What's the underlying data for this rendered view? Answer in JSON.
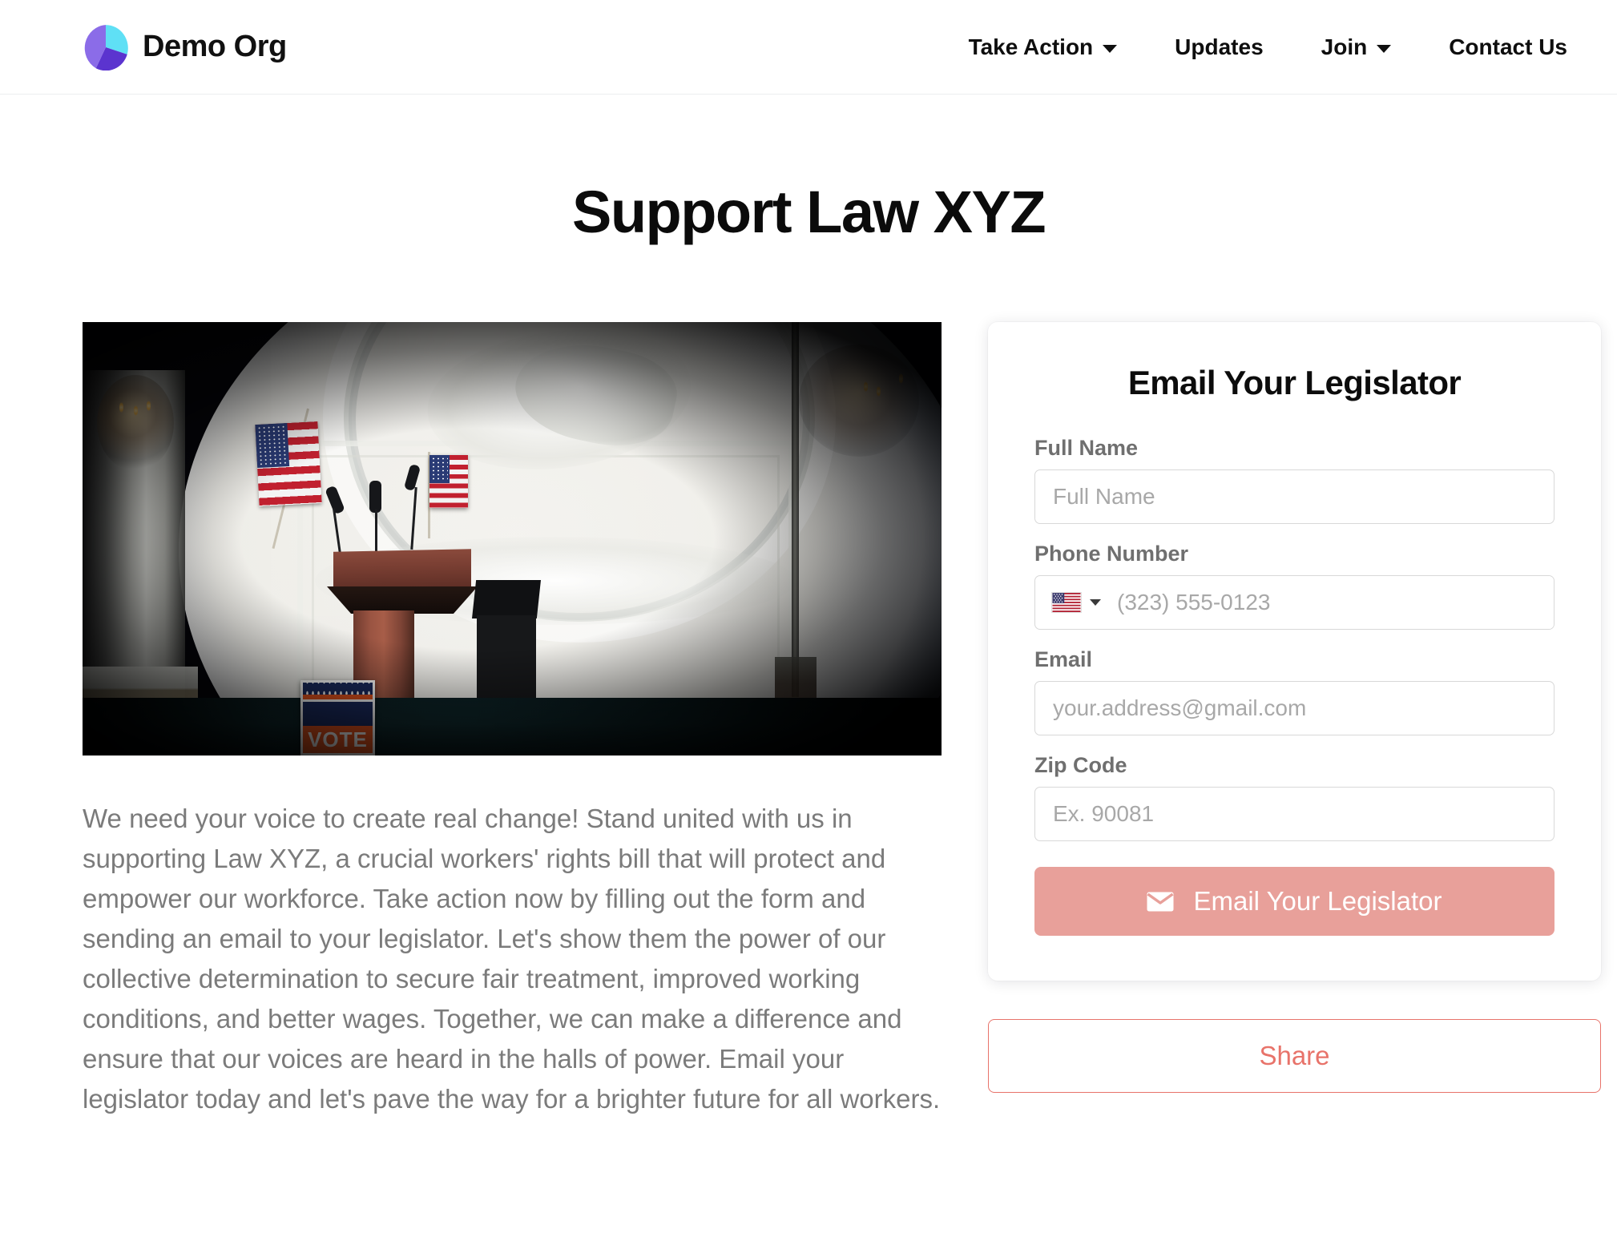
{
  "header": {
    "brand_name": "Demo Org",
    "logo_icon": "pie-chart-logo",
    "logo_colors": {
      "light_purple": "#8b6ce8",
      "cyan": "#5fe0f5",
      "dark_purple": "#5b34cf"
    },
    "nav": [
      {
        "label": "Take Action",
        "has_dropdown": true,
        "icon": "chevron-down-icon"
      },
      {
        "label": "Updates",
        "has_dropdown": false,
        "icon": ""
      },
      {
        "label": "Join",
        "has_dropdown": true,
        "icon": "chevron-down-icon"
      },
      {
        "label": "Contact Us",
        "has_dropdown": false,
        "icon": ""
      }
    ]
  },
  "page": {
    "title": "Support Law XYZ"
  },
  "hero": {
    "image_alt": "Empty podium with microphones and American flags on a stage, VOTE sign in front",
    "sign_text": "VOTE"
  },
  "body": {
    "paragraph": "We need your voice to create real change! Stand united with us in supporting Law XYZ, a crucial workers' rights bill that will protect and empower our workforce. Take action now by filling out the form and sending an email to your legislator. Let's show them the power of our collective determination to secure fair treatment, improved working conditions, and better wages. Together, we can make a difference and ensure that our voices are heard in the halls of power. Email your legislator today and let's pave the way for a brighter future for all workers."
  },
  "form": {
    "title": "Email Your Legislator",
    "fields": {
      "full_name": {
        "label": "Full Name",
        "value": "",
        "placeholder": "Full Name"
      },
      "phone": {
        "label": "Phone Number",
        "value": "",
        "placeholder": "(323) 555-0123",
        "country_flag": "us-flag-icon",
        "country_caret": "chevron-down-icon"
      },
      "email": {
        "label": "Email",
        "value": "",
        "placeholder": "your.address@gmail.com"
      },
      "zip": {
        "label": "Zip Code",
        "value": "",
        "placeholder": "Ex. 90081"
      }
    },
    "submit": {
      "label": "Email Your Legislator",
      "icon": "envelope-icon",
      "color": "#e8a09a"
    }
  },
  "share": {
    "label": "Share",
    "color": "#e8736a"
  }
}
